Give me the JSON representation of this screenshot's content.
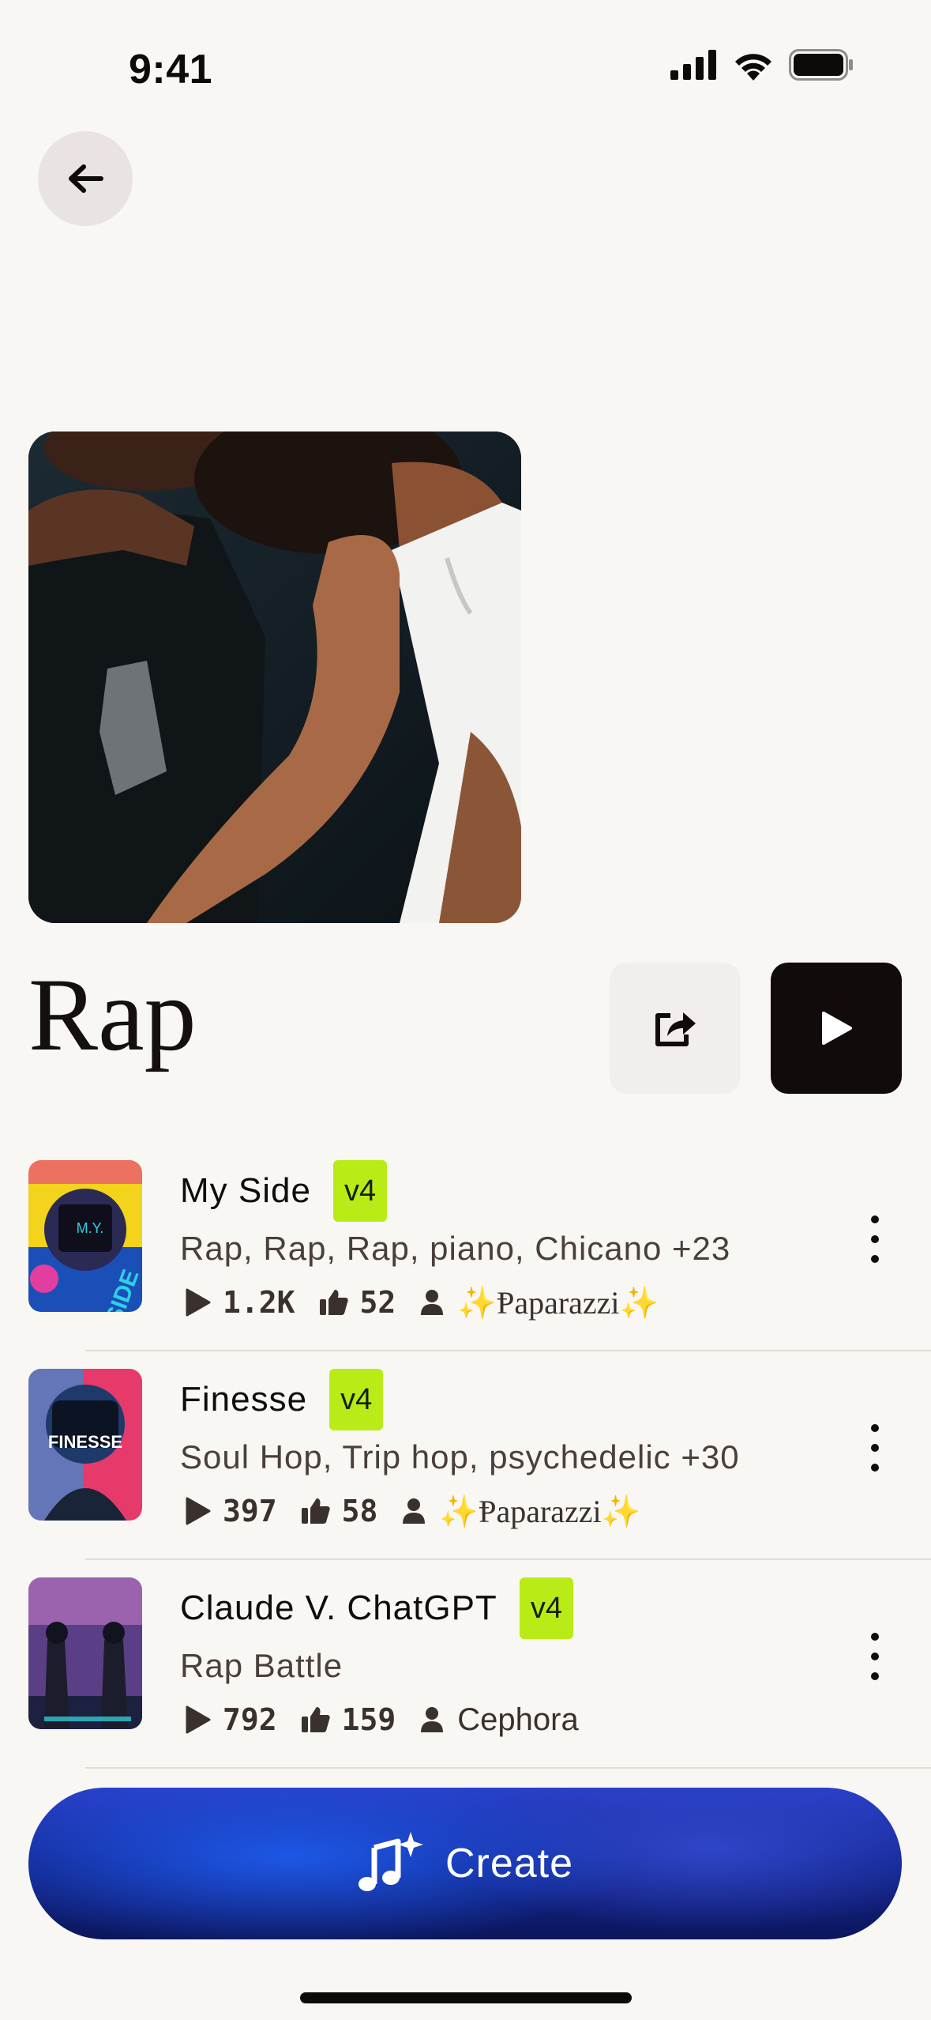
{
  "status_bar": {
    "time": "9:41"
  },
  "playlist": {
    "title": "Rap",
    "cover_icon": "photo-two-men-dancing"
  },
  "songs": [
    {
      "name": "My Side",
      "version": "v4",
      "tags": "Rap, Rap, Rap, piano, Chicano +23",
      "plays": "1.2K",
      "likes": "52",
      "author": "✨Ᵽaparazzi✨",
      "thumb_text": "SIDE"
    },
    {
      "name": "Finesse",
      "version": "v4",
      "tags": "Soul Hop, Trip hop, psychedelic +30",
      "plays": "397",
      "likes": "58",
      "author": "✨Ᵽaparazzi✨",
      "thumb_text": "FINESSE"
    },
    {
      "name": "Claude V. ChatGPT",
      "version": "v4",
      "tags": "Rap Battle",
      "plays": "792",
      "likes": "159",
      "author": "Cephora",
      "thumb_text": ""
    }
  ],
  "create_button": {
    "label": "Create"
  },
  "colors": {
    "background": "#f9f7f4",
    "version_badge": "#b9ec16",
    "create_gradient_top": "#2a3fc8",
    "create_gradient_bottom": "#0c165c",
    "play_button": "#120b0b"
  }
}
